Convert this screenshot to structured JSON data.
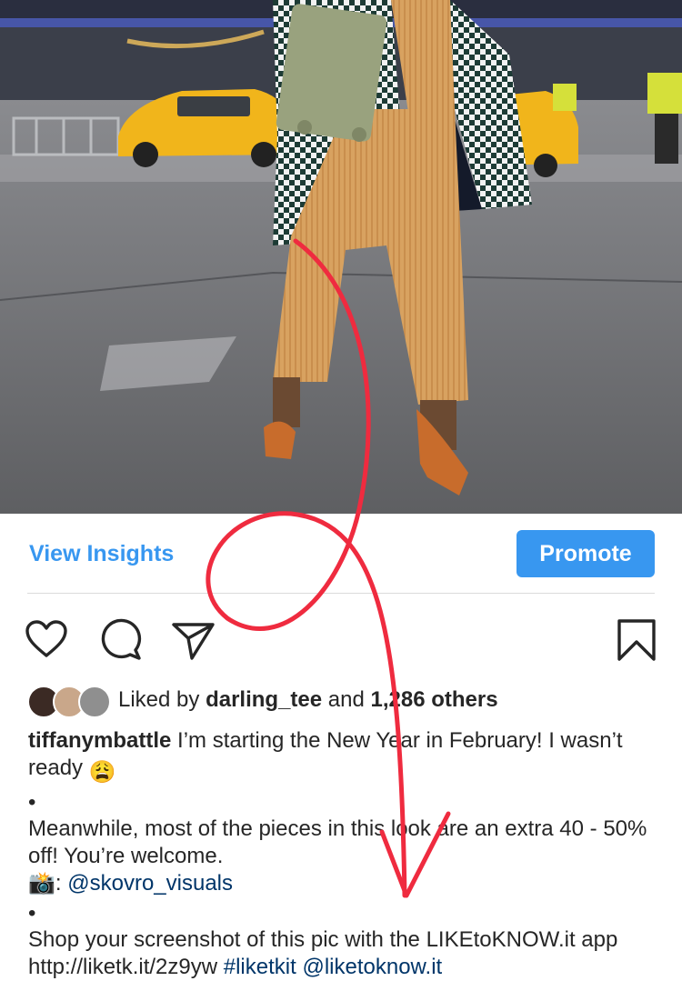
{
  "post": {
    "photo_alt": "Street style photo",
    "photo_icon": "street-photo"
  },
  "insights": {
    "view_insights_label": "View Insights",
    "promote_label": "Promote"
  },
  "actions": {
    "like_icon": "heart-icon",
    "comment_icon": "comment-icon",
    "share_icon": "paper-plane-icon",
    "save_icon": "bookmark-icon"
  },
  "likes": {
    "prefix": "Liked by ",
    "liker": "darling_tee",
    "middle": " and ",
    "others": "1,286 others"
  },
  "caption": {
    "username": "tiffanymbattle",
    "line1": " I’m starting the New Year in February! I wasn’t ready ",
    "emoji1": "😩",
    "bullet": "•",
    "paragraph2": "Meanwhile, most of the pieces in this look are an extra 40 - 50% off! You’re welcome.",
    "camera_emoji": "📸",
    "credit_sep": ": ",
    "credit_handle": "@skovro_visuals",
    "shop_text": "Shop your screenshot of this pic with the LIKEtoKNOW.it app ",
    "shop_link": "http://liketk.it/2z9yw",
    "space": " ",
    "hashtag": "#liketkit",
    "mention": "@liketoknow.it"
  },
  "colors": {
    "accent_blue": "#3897f0",
    "link_navy": "#003569",
    "annotation_red": "#ef2b3f"
  }
}
